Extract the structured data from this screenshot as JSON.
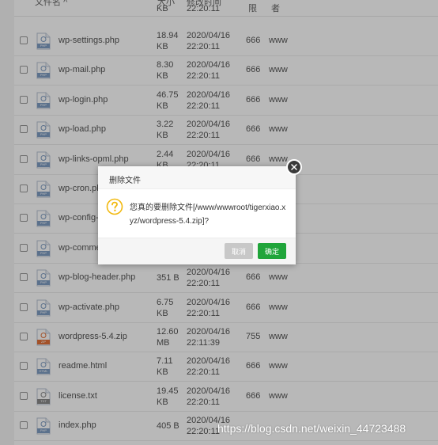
{
  "header": {
    "name_col": "文件名",
    "sort_arrow": "^",
    "size_col": "大小",
    "time_col": "修改时间",
    "perm_col": "限",
    "owner_col": "者"
  },
  "files": [
    {
      "name": "wp-settings.php",
      "size_value": "18.94",
      "size_unit": "KB",
      "date": "2020/04/16",
      "time": "22:20:11",
      "perm": "666",
      "owner": "www",
      "type_label": "PHP"
    },
    {
      "name": "wp-mail.php",
      "size_value": "8.30",
      "size_unit": "KB",
      "date": "2020/04/16",
      "time": "22:20:11",
      "perm": "666",
      "owner": "www",
      "type_label": "PHP"
    },
    {
      "name": "wp-login.php",
      "size_value": "46.75",
      "size_unit": "KB",
      "date": "2020/04/16",
      "time": "22:20:11",
      "perm": "666",
      "owner": "www",
      "type_label": "PHP"
    },
    {
      "name": "wp-load.php",
      "size_value": "3.22",
      "size_unit": "KB",
      "date": "2020/04/16",
      "time": "22:20:11",
      "perm": "666",
      "owner": "www",
      "type_label": "PHP"
    },
    {
      "name": "wp-links-opml.php",
      "size_value": "2.44",
      "size_unit": "KB",
      "date": "2020/04/16",
      "time": "22:20:11",
      "perm": "666",
      "owner": "www",
      "type_label": "PHP"
    },
    {
      "name": "wp-cron.php",
      "size_value": "",
      "size_unit": "",
      "date": "",
      "time": "",
      "perm": "",
      "owner": "",
      "type_label": "PHP"
    },
    {
      "name": "wp-config-",
      "size_value": "",
      "size_unit": "",
      "date": "",
      "time": "",
      "perm": "",
      "owner": "",
      "type_label": "PHP"
    },
    {
      "name": "wp-comme",
      "size_value": "",
      "size_unit": "",
      "date": "",
      "time": "",
      "perm": "",
      "owner": "",
      "type_label": "PHP"
    },
    {
      "name": "wp-blog-header.php",
      "size_value": "351 B",
      "size_unit": "",
      "date": "2020/04/16",
      "time": "22:20:11",
      "perm": "666",
      "owner": "www",
      "type_label": "PHP"
    },
    {
      "name": "wp-activate.php",
      "size_value": "6.75",
      "size_unit": "KB",
      "date": "2020/04/16",
      "time": "22:20:11",
      "perm": "666",
      "owner": "www",
      "type_label": "PHP"
    },
    {
      "name": "wordpress-5.4.zip",
      "size_value": "12.60",
      "size_unit": "MB",
      "date": "2020/04/16",
      "time": "22:11:39",
      "perm": "755",
      "owner": "www",
      "type_label": "ZIP"
    },
    {
      "name": "readme.html",
      "size_value": "7.11",
      "size_unit": "KB",
      "date": "2020/04/16",
      "time": "22:20:11",
      "perm": "666",
      "owner": "www",
      "type_label": "HTML"
    },
    {
      "name": "license.txt",
      "size_value": "19.45",
      "size_unit": "KB",
      "date": "2020/04/16",
      "time": "22:20:11",
      "perm": "666",
      "owner": "www",
      "type_label": "TXT"
    },
    {
      "name": "index.php",
      "size_value": "405 B",
      "size_unit": "",
      "date": "2020/04/16",
      "time": "22:20:11",
      "perm": "",
      "owner": "",
      "type_label": "PHP"
    }
  ],
  "partial_top_row": {
    "size_unit": "KB",
    "time": "22:20:11"
  },
  "dialog": {
    "title": "删除文件",
    "message": "您真的要删除文件[/www/wwwroot/tigerxiao.xyz/wordpress-5.4.zip]?",
    "cancel_label": "取消",
    "confirm_label": "确定",
    "question_icon": "question-icon",
    "close_icon": "close-icon"
  },
  "watermark": "https://blog.csdn.net/weixin_44723488",
  "colors": {
    "confirm_green": "#20a53a",
    "warn_yellow": "#f2b90f",
    "zip_orange": "#e27138",
    "file_blue": "#7f9dc3"
  }
}
